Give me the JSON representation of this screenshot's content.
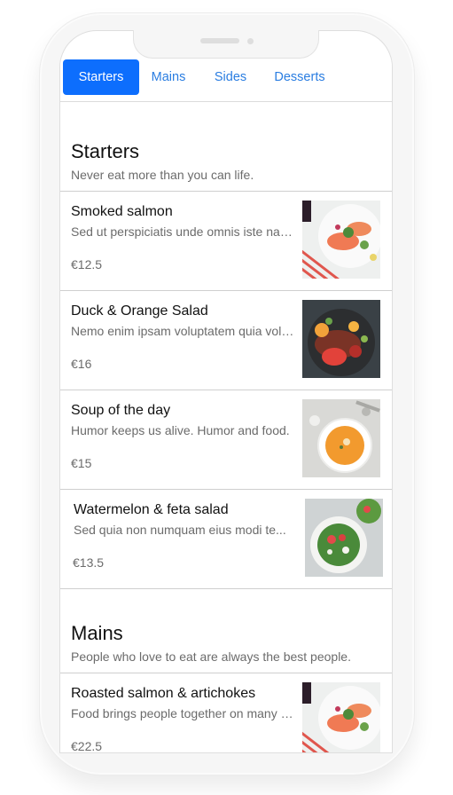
{
  "tabs": [
    {
      "label": "Starters",
      "active": true
    },
    {
      "label": "Mains",
      "active": false
    },
    {
      "label": "Sides",
      "active": false
    },
    {
      "label": "Desserts",
      "active": false
    }
  ],
  "sections": [
    {
      "title": "Starters",
      "subtitle": "Never eat more than you can life.",
      "items": [
        {
          "name": "Smoked salmon",
          "description": "Sed ut perspiciatis unde omnis iste natus error",
          "price": "€12.5",
          "image": "salmon-plate"
        },
        {
          "name": "Duck & Orange Salad",
          "description": "Nemo enim ipsam voluptatem quia voluptas",
          "price": "€16",
          "image": "duck-plate"
        },
        {
          "name": "Soup of the day",
          "description": "Humor keeps us alive. Humor and food.",
          "price": "€15",
          "image": "soup-bowl"
        },
        {
          "name": "Watermelon & feta salad",
          "description": "Sed quia non numquam eius modi te...",
          "price": "€13.5",
          "image": "salad-bowl"
        }
      ]
    },
    {
      "title": "Mains",
      "subtitle": "People who love to eat are always the best people.",
      "items": [
        {
          "name": "Roasted salmon & artichokes",
          "description": "Food brings people together on many levels",
          "price": "€22.5",
          "image": "salmon-plate"
        }
      ]
    }
  ]
}
